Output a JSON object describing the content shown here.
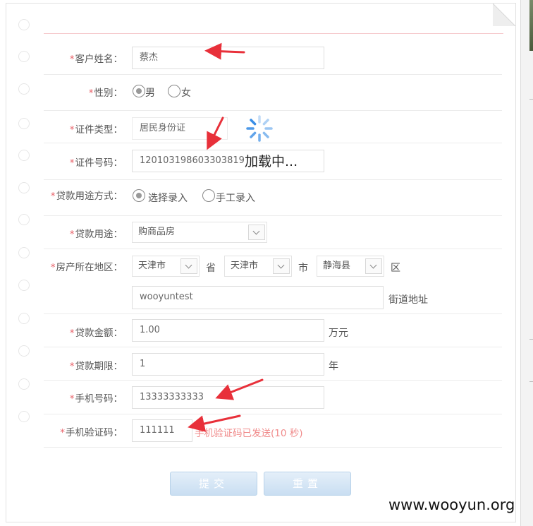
{
  "form": {
    "customer_name": {
      "label": "客户姓名：",
      "value": "蔡杰"
    },
    "gender": {
      "label": "性别：",
      "options": [
        "男",
        "女"
      ],
      "selected": "男"
    },
    "id_type": {
      "label": "证件类型：",
      "value": "居民身份证"
    },
    "id_number": {
      "label": "证件号码：",
      "value": "120103198603303819"
    },
    "purpose_mode": {
      "label": "贷款用途方式：",
      "options": [
        "选择录入",
        "手工录入"
      ],
      "selected": "选择录入"
    },
    "loan_purpose": {
      "label": "贷款用途：",
      "value": "购商品房"
    },
    "property_location": {
      "label": "房产所在地区：",
      "province": "天津市",
      "province_unit": "省",
      "city": "天津市",
      "city_unit": "市",
      "district": "静海县",
      "district_unit": "区",
      "street": "wooyuntest",
      "street_unit": "街道地址"
    },
    "loan_amount": {
      "label": "贷款金额：",
      "value": "1.00",
      "unit": "万元"
    },
    "loan_term": {
      "label": "贷款期限：",
      "value": "1",
      "unit": "年"
    },
    "mobile": {
      "label": "手机号码：",
      "value": "13333333333"
    },
    "sms_code": {
      "label": "手机验证码：",
      "value": "111111",
      "note": "手机验证码已发送(10 秒)"
    }
  },
  "required_mark": "*",
  "buttons": {
    "submit": "提交",
    "reset": "重置"
  },
  "loading": {
    "text": "加载中..."
  },
  "watermark": "www.wooyun.org",
  "colors": {
    "required": "#e8646b",
    "note": "#f08a8a",
    "button": "#c9def2",
    "arrow": "#e8303a",
    "spinner": "#3a8ee6"
  }
}
